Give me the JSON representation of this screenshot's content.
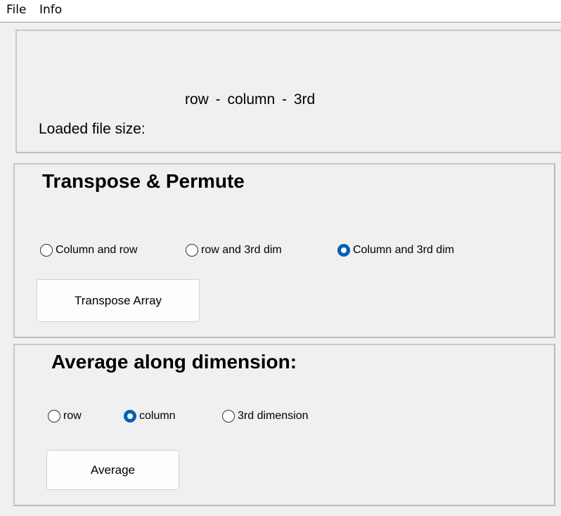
{
  "menubar": {
    "items": [
      {
        "label": "File"
      },
      {
        "label": "Info"
      }
    ]
  },
  "info_panel": {
    "dims_label": "row  -  column  -  3rd",
    "filesize_label": "Loaded file size:"
  },
  "transpose_panel": {
    "title": "Transpose & Permute",
    "options": [
      {
        "label": "Column and row",
        "checked": false
      },
      {
        "label": "row and 3rd dim",
        "checked": false
      },
      {
        "label": "Column and 3rd dim",
        "checked": true
      }
    ],
    "button_label": "Transpose Array"
  },
  "average_panel": {
    "title": "Average along dimension:",
    "options": [
      {
        "label": "row",
        "checked": false
      },
      {
        "label": "column",
        "checked": true
      },
      {
        "label": "3rd dimension",
        "checked": false
      }
    ],
    "button_label": "Average"
  },
  "colors": {
    "accent": "#005fb8",
    "background": "#f0f0f0"
  }
}
